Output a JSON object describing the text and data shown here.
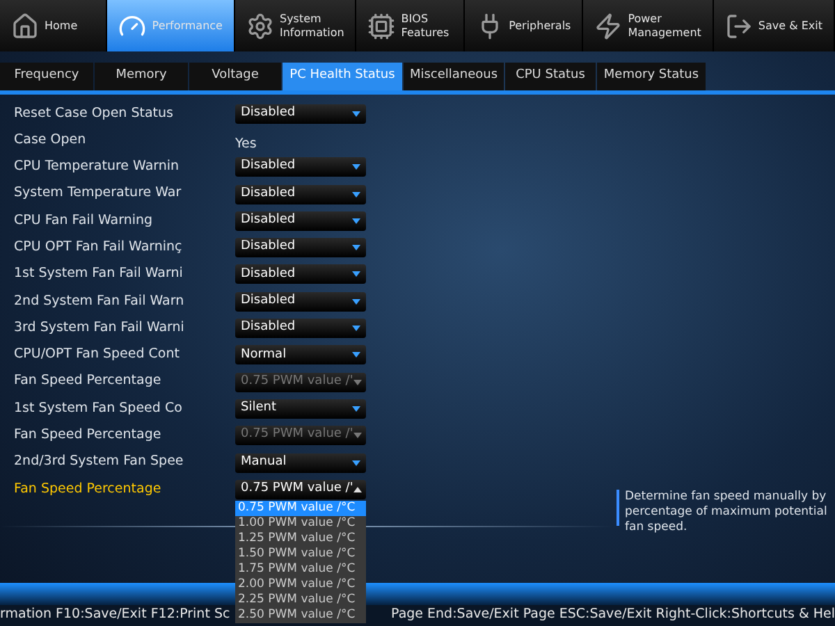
{
  "nav": [
    {
      "label": "Home",
      "selected": false
    },
    {
      "label": "Performance",
      "selected": true
    },
    {
      "label": "System\nInformation",
      "selected": false
    },
    {
      "label": "BIOS\nFeatures",
      "selected": false
    },
    {
      "label": "Peripherals",
      "selected": false
    },
    {
      "label": "Power\nManagement",
      "selected": false
    },
    {
      "label": "Save & Exit",
      "selected": false
    }
  ],
  "tabs": [
    {
      "label": "Frequency",
      "selected": false
    },
    {
      "label": "Memory",
      "selected": false
    },
    {
      "label": "Voltage",
      "selected": false
    },
    {
      "label": "PC Health Status",
      "selected": true
    },
    {
      "label": "Miscellaneous",
      "selected": false
    },
    {
      "label": "CPU Status",
      "selected": false
    },
    {
      "label": "Memory Status",
      "selected": false
    }
  ],
  "settings": [
    {
      "label": "Reset Case Open Status",
      "kind": "select",
      "value": "Disabled",
      "disabled": false,
      "selected": false,
      "expanded": false
    },
    {
      "label": "Case Open",
      "kind": "text",
      "value": "Yes",
      "selected": false
    },
    {
      "label": "CPU Temperature Warnin",
      "kind": "select",
      "value": "Disabled",
      "disabled": false,
      "selected": false,
      "expanded": false
    },
    {
      "label": "System Temperature War",
      "kind": "select",
      "value": "Disabled",
      "disabled": false,
      "selected": false,
      "expanded": false
    },
    {
      "label": "CPU Fan Fail Warning",
      "kind": "select",
      "value": "Disabled",
      "disabled": false,
      "selected": false,
      "expanded": false
    },
    {
      "label": "CPU OPT Fan Fail Warninç",
      "kind": "select",
      "value": "Disabled",
      "disabled": false,
      "selected": false,
      "expanded": false
    },
    {
      "label": "1st System Fan Fail Warni",
      "kind": "select",
      "value": "Disabled",
      "disabled": false,
      "selected": false,
      "expanded": false
    },
    {
      "label": "2nd System Fan Fail Warn",
      "kind": "select",
      "value": "Disabled",
      "disabled": false,
      "selected": false,
      "expanded": false
    },
    {
      "label": "3rd System Fan Fail Warni",
      "kind": "select",
      "value": "Disabled",
      "disabled": false,
      "selected": false,
      "expanded": false
    },
    {
      "label": "CPU/OPT Fan Speed Cont",
      "kind": "select",
      "value": "Normal",
      "disabled": false,
      "selected": false,
      "expanded": false
    },
    {
      "label": "Fan Speed Percentage",
      "kind": "select",
      "value": "0.75 PWM value /'",
      "disabled": true,
      "selected": false,
      "expanded": false
    },
    {
      "label": "1st System Fan Speed Co",
      "kind": "select",
      "value": "Silent",
      "disabled": false,
      "selected": false,
      "expanded": false
    },
    {
      "label": "Fan Speed Percentage",
      "kind": "select",
      "value": "0.75 PWM value /'",
      "disabled": true,
      "selected": false,
      "expanded": false
    },
    {
      "label": "2nd/3rd System Fan Spee",
      "kind": "select",
      "value": "Manual",
      "disabled": false,
      "selected": false,
      "expanded": false
    },
    {
      "label": "Fan Speed Percentage",
      "kind": "select",
      "value": "0.75 PWM value /'",
      "disabled": false,
      "selected": true,
      "expanded": true
    }
  ],
  "dropdown_options": [
    {
      "label": "0.75 PWM value /°C",
      "selected": true
    },
    {
      "label": "1.00 PWM value /°C",
      "selected": false
    },
    {
      "label": "1.25 PWM value /°C",
      "selected": false
    },
    {
      "label": "1.50 PWM value /°C",
      "selected": false
    },
    {
      "label": "1.75 PWM value /°C",
      "selected": false
    },
    {
      "label": "2.00 PWM value /°C",
      "selected": false
    },
    {
      "label": "2.25 PWM value /°C",
      "selected": false
    },
    {
      "label": "2.50 PWM value /°C",
      "selected": false
    }
  ],
  "help_text": "Determine fan speed manually by percentage of maximum potential fan speed.",
  "status_bar": [
    "rmation F10:Save/Exit F12:Print Sc",
    "Page End:Save/Exit Page ESC:Save/Exit Right-Click:Shortcuts & Hel"
  ]
}
